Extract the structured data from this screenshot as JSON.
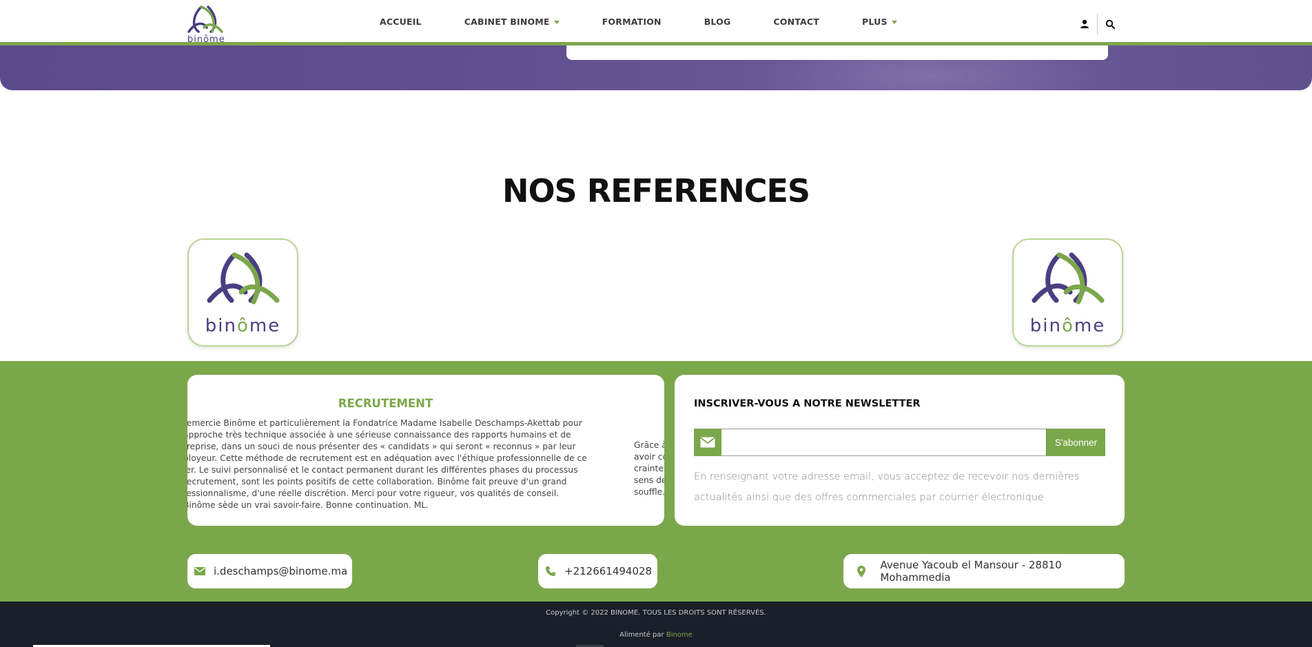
{
  "brand": {
    "logo_text": "binôme",
    "colors": {
      "green": "#7ba74b",
      "purple": "#4a3f82",
      "footer": "#1a2029"
    }
  },
  "nav": {
    "items": [
      {
        "label": "ACCUEIL",
        "has_dropdown": false
      },
      {
        "label": "CABINET BINOME",
        "has_dropdown": true
      },
      {
        "label": "FORMATION",
        "has_dropdown": false
      },
      {
        "label": "BLOG",
        "has_dropdown": false
      },
      {
        "label": "CONTACT",
        "has_dropdown": false
      },
      {
        "label": "PLUS",
        "has_dropdown": true
      }
    ],
    "icons": [
      "user-icon",
      "search-icon"
    ]
  },
  "references": {
    "title": "NOS REFERENCES",
    "logo_word_a": "bin",
    "logo_word_o": "ô",
    "logo_word_b": "me"
  },
  "recrutement": {
    "title": "RECRUTEMENT",
    "text": "remercie Binôme et particulièrement la Fondatrice Madame Isabelle Deschamps-Akettab pour approche très technique associée à une sérieuse connaissance des rapports humains et de treprise, dans un souci de nous présenter des « candidats » qui seront « reconnus » par leur ployeur. Cette méthode de recrutement est en adéquation avec l'éthique professionnelle de ce ier. Le suivi personnalisé et le contact permanent durant les différentes phases du processus recrutement, sont les points positifs de cette collaboration. Binôme fait preuve d'un grand fessionnalisme, d'une réelle discrétion. Merci pour votre rigueur, vos qualités de conseil. Binôme sède un vrai savoir-faire. Bonne continuation. ML.",
    "text_next": "Grâce à\navoir co\ncrainte\nsens de\nsouffle."
  },
  "newsletter": {
    "title": "INSCRIVER-VOUS A NOTRE NEWSLETTER",
    "input_value": "",
    "input_placeholder": "",
    "button_label": "S'abonner",
    "note": "En renseignant votre adresse email, vous acceptez de recevoir nos dernières actualités ainsi que des offres commerciales par courrier électronique"
  },
  "contact": {
    "email": "i.deschamps@binome.ma",
    "phone": "+212661494028",
    "address": "Avenue Yacoub el Mansour - 28810 Mohammedia"
  },
  "footer": {
    "copyright": "Copyright © 2022 BINOME. TOUS LES DROITS SONT RÉSERVÉS.",
    "powered_prefix": "Alimenté par",
    "powered_link": "Binome"
  }
}
